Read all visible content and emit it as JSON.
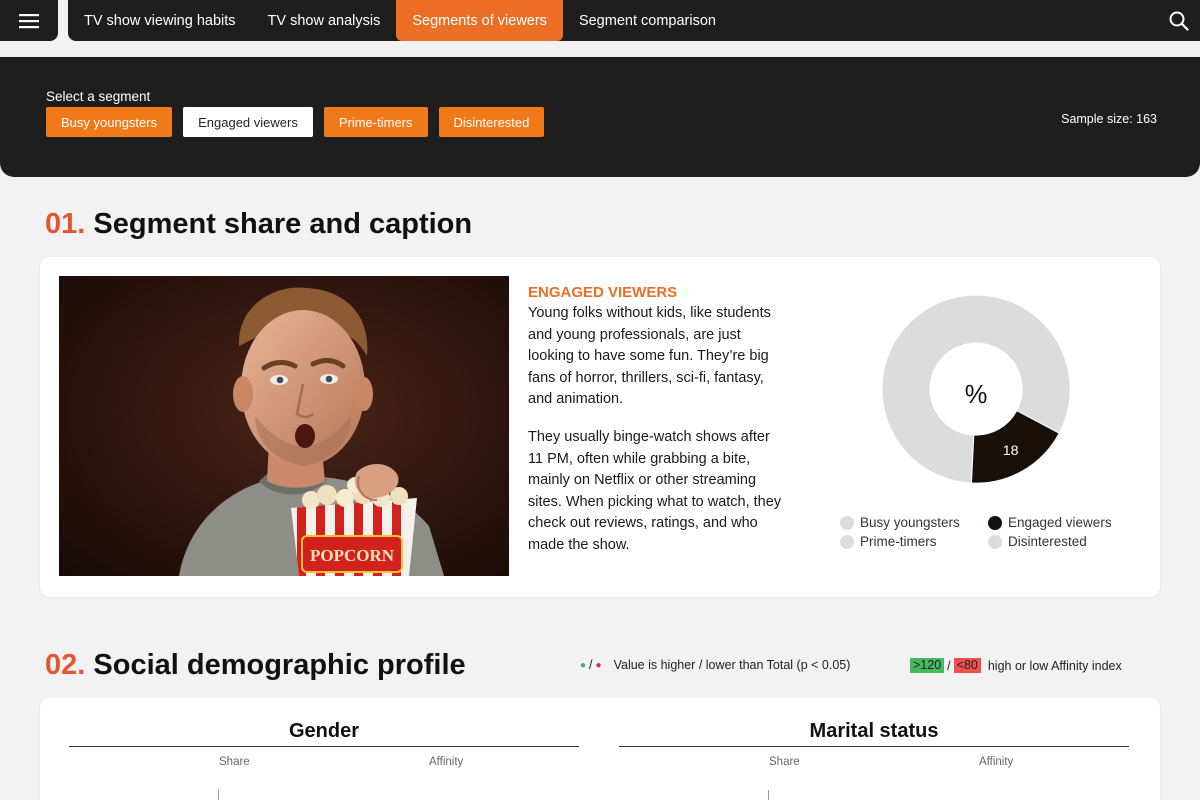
{
  "nav": {
    "tabs": [
      {
        "label": "TV show viewing habits",
        "active": false
      },
      {
        "label": "TV show analysis",
        "active": false
      },
      {
        "label": "Segments of viewers",
        "active": true
      },
      {
        "label": "Segment comparison",
        "active": false
      }
    ]
  },
  "segment_selector": {
    "label": "Select a segment",
    "options": [
      "Busy youngsters",
      "Engaged viewers",
      "Prime-timers",
      "Disinterested"
    ],
    "selected": "Engaged viewers",
    "sample_size": "Sample size: 163"
  },
  "section1": {
    "number": "01.",
    "title": "Segment share and caption",
    "photo_label": "POPCORN",
    "caption_heading": "ENGAGED VIEWERS",
    "caption_p1": "Young folks without kids, like students and young professionals, are just looking to have some fun. They’re big fans of horror, thrillers, sci-fi, fantasy, and animation.",
    "caption_p2": "They usually binge-watch shows after 11 PM, often while grabbing a bite, mainly on Netflix or other streaming sites. When picking what to watch, they check out reviews, ratings, and who made the show.",
    "donut_center": "%",
    "donut_value_label": "18",
    "donut_value": 18,
    "legend": [
      "Busy youngsters",
      "Engaged viewers",
      "Prime-timers",
      "Disinterested"
    ]
  },
  "section2": {
    "number": "02.",
    "title": "Social demographic profile",
    "sig_separator": "/",
    "sig_text": "Value is higher / lower than Total (p < 0.05)",
    "aff_high": ">120",
    "aff_separator": "/",
    "aff_low": "<80",
    "aff_text": "high or low Affinity index",
    "columns": [
      {
        "title": "Gender",
        "share": "Share",
        "affinity": "Affinity"
      },
      {
        "title": "Marital status",
        "share": "Share",
        "affinity": "Affinity"
      }
    ]
  },
  "colors": {
    "accent": "#ec6f25",
    "section_number": "#e4572e",
    "dark": "#1e1e1e",
    "highlight_segment": "#181008",
    "muted_segment": "#dcdcdc"
  }
}
